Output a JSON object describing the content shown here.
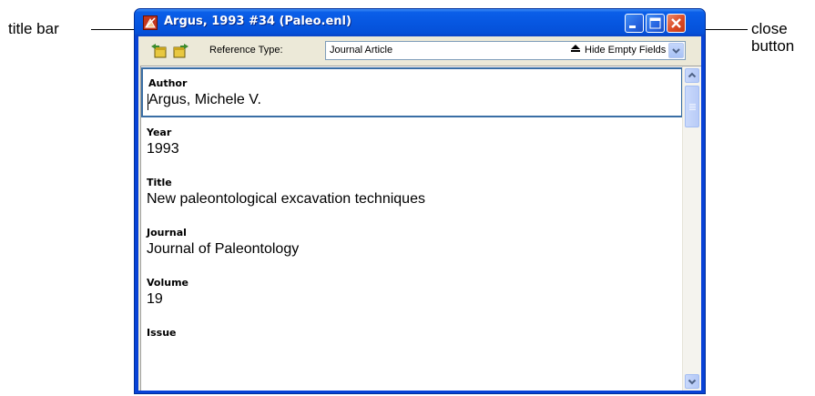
{
  "callouts": {
    "title_bar": "title bar",
    "close_button_line1": "close",
    "close_button_line2": "button"
  },
  "window": {
    "title": "Argus, 1993 #34 (Paleo.enl)",
    "icon": "endnote-app-icon",
    "controls": [
      "minimize-icon",
      "maximize-icon",
      "close-icon"
    ]
  },
  "toolbar": {
    "reference_type_label": "Reference Type:",
    "reference_type_value": "Journal Article",
    "hide_empty_label": "Hide Empty Fields",
    "icons": [
      "previous-reference-icon",
      "next-reference-icon",
      "up-arrow-icon"
    ]
  },
  "fields": [
    {
      "label": "Author",
      "value": "Argus, Michele V."
    },
    {
      "label": "Year",
      "value": "1993"
    },
    {
      "label": "Title",
      "value": "New paleontological excavation techniques"
    },
    {
      "label": "Journal",
      "value": "Journal of Paleontology"
    },
    {
      "label": "Volume",
      "value": "19"
    },
    {
      "label": "Issue",
      "value": ""
    }
  ],
  "colors": {
    "titlebar": "#0757e1",
    "close_button": "#db4a24",
    "window_face": "#ece9d8",
    "focus_border": "#3a6ea5"
  }
}
